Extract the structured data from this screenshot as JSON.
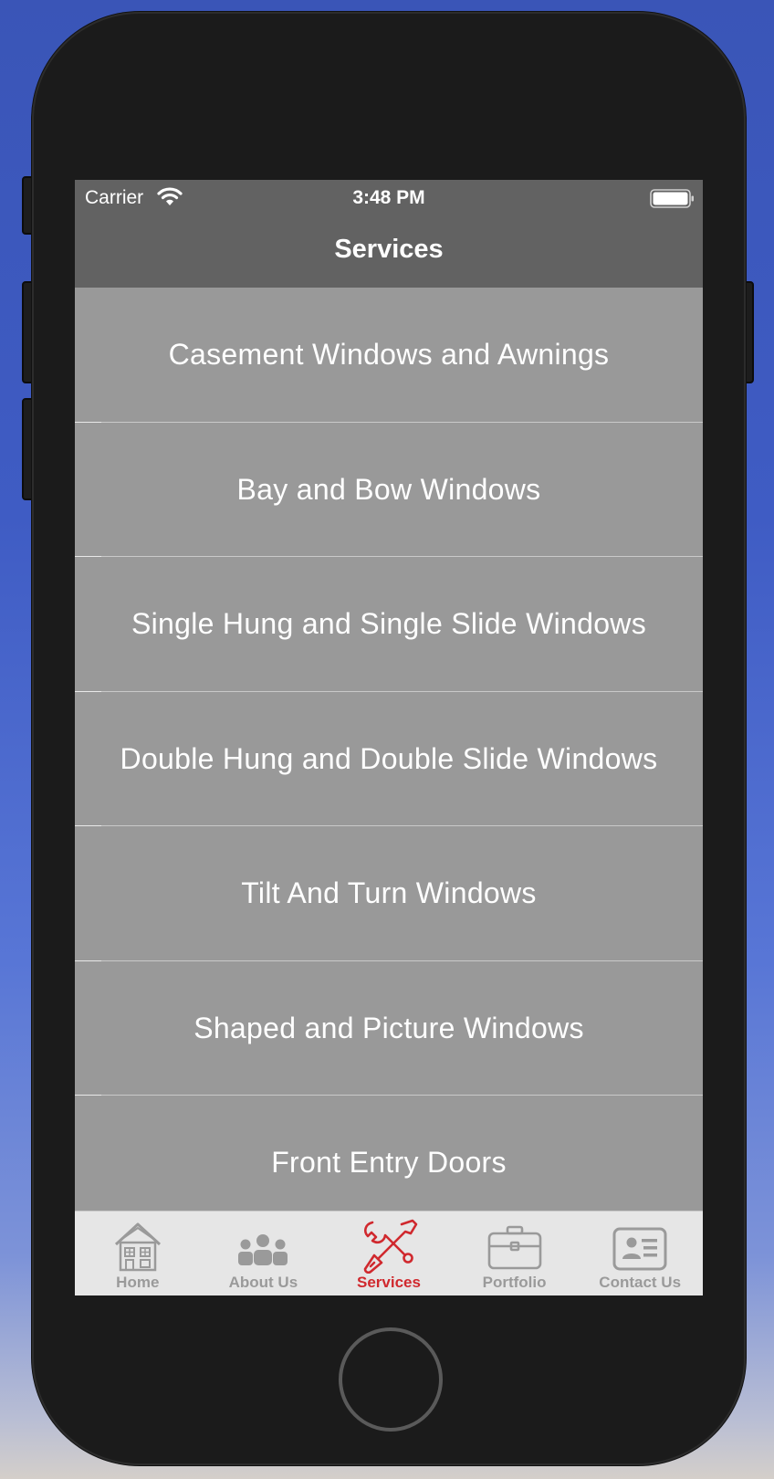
{
  "status_bar": {
    "carrier": "Carrier",
    "time": "3:48 PM",
    "wifi_icon": "wifi-icon",
    "battery_icon": "battery-icon"
  },
  "nav": {
    "title": "Services"
  },
  "services": [
    "Casement Windows and Awnings",
    "Bay and Bow Windows",
    "Single Hung and Single Slide Windows",
    "Double Hung and Double Slide Windows",
    "Tilt And Turn Windows",
    "Shaped and Picture Windows",
    "Front Entry Doors"
  ],
  "tabs": [
    {
      "label": "Home",
      "icon": "house-icon",
      "active": false
    },
    {
      "label": "About Us",
      "icon": "people-icon",
      "active": false
    },
    {
      "label": "Services",
      "icon": "tools-icon",
      "active": true
    },
    {
      "label": "Portfolio",
      "icon": "briefcase-icon",
      "active": false
    },
    {
      "label": "Contact Us",
      "icon": "contact-card-icon",
      "active": false
    }
  ],
  "colors": {
    "accent": "#d0292e",
    "inactive_tab": "#9a9a9a",
    "nav_background": "#626262",
    "list_background": "#999999",
    "tab_bar_background": "#e6e6e6"
  }
}
